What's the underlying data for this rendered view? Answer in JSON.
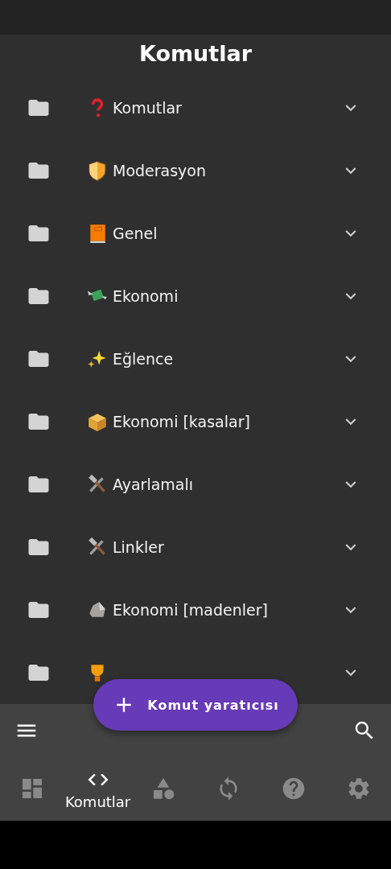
{
  "header": {
    "title": "Komutlar"
  },
  "folders": [
    {
      "kind": "question",
      "label": "Komutlar",
      "expanded": false
    },
    {
      "kind": "shield",
      "label": "Moderasyon",
      "expanded": false
    },
    {
      "kind": "book",
      "label": "Genel",
      "expanded": false
    },
    {
      "kind": "money",
      "label": "Ekonomi",
      "expanded": false
    },
    {
      "kind": "sparkles",
      "label": "Eğlence",
      "expanded": false
    },
    {
      "kind": "package",
      "label": "Ekonomi [kasalar]",
      "expanded": false
    },
    {
      "kind": "tools",
      "label": "Ayarlamalı",
      "expanded": false
    },
    {
      "kind": "tools",
      "label": "Linkler",
      "expanded": false
    },
    {
      "kind": "rock",
      "label": "Ekonomi [madenler]",
      "expanded": false
    },
    {
      "kind": "trophy",
      "expanded": false
    }
  ],
  "fab": {
    "label": "Komut yaratıcısı"
  },
  "nav": [
    {
      "kind": "dashboard",
      "selected": false
    },
    {
      "kind": "code",
      "selected": true,
      "label": "Komutlar"
    },
    {
      "kind": "shapes",
      "selected": false
    },
    {
      "kind": "sync",
      "selected": false
    },
    {
      "kind": "help",
      "selected": false
    },
    {
      "kind": "settings",
      "selected": false
    }
  ]
}
